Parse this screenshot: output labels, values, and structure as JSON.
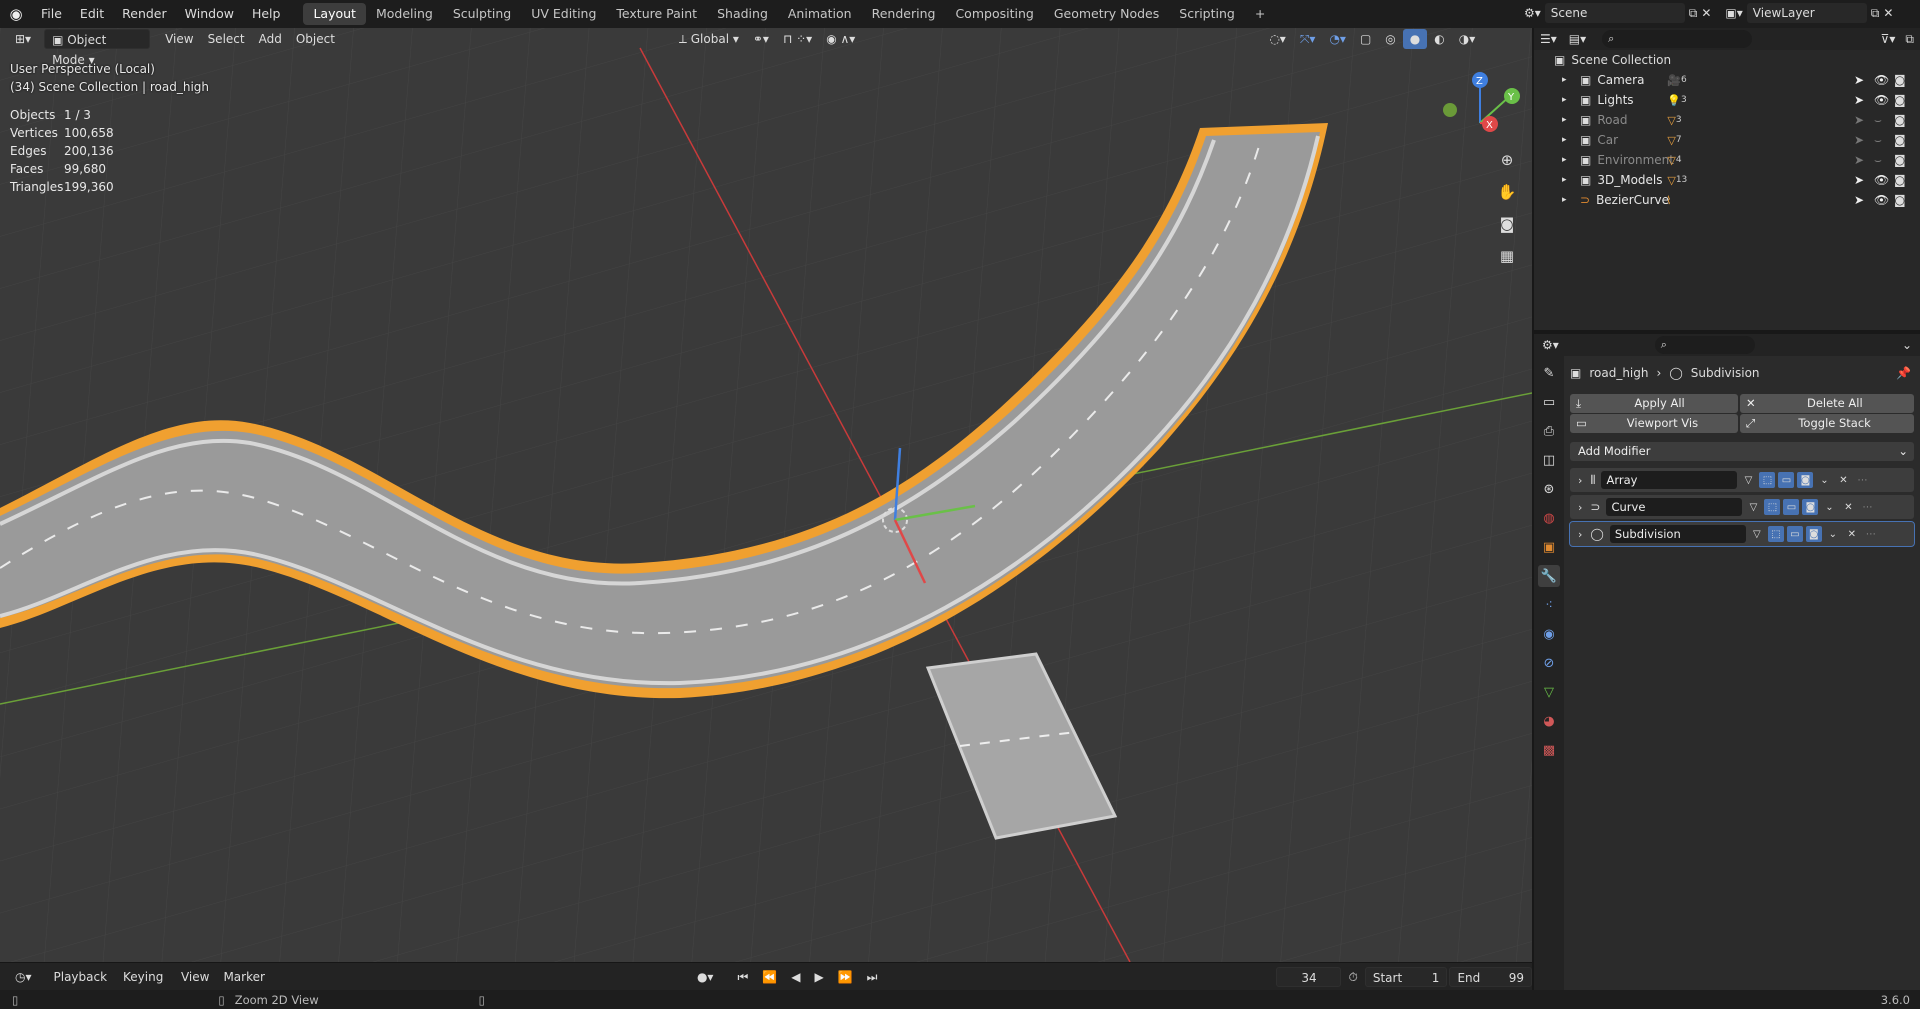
{
  "topbar": {
    "menus": [
      "File",
      "Edit",
      "Render",
      "Window",
      "Help"
    ],
    "workspaces": [
      "Layout",
      "Modeling",
      "Sculpting",
      "UV Editing",
      "Texture Paint",
      "Shading",
      "Animation",
      "Rendering",
      "Compositing",
      "Geometry Nodes",
      "Scripting"
    ],
    "active_workspace": "Layout",
    "add_symbol": "+",
    "scene_label": "Scene",
    "viewlayer_label": "ViewLayer"
  },
  "viewport": {
    "mode": "Object Mode",
    "menus": [
      "View",
      "Select",
      "Add",
      "Object"
    ],
    "transform_orientation": "Global",
    "perspective_text": "User Perspective (Local)",
    "collection_text": "(34) Scene Collection | road_high",
    "stats": [
      {
        "key": "Objects",
        "value": "1 / 3"
      },
      {
        "key": "Vertices",
        "value": "100,658"
      },
      {
        "key": "Edges",
        "value": "200,136"
      },
      {
        "key": "Faces",
        "value": "99,680"
      },
      {
        "key": "Triangles",
        "value": "199,360"
      }
    ],
    "gizmo_axes": {
      "x": "X",
      "y": "Y",
      "z": "Z"
    },
    "colors": {
      "bg": "#3a3a3a",
      "selection": "#f0a030",
      "x_axis": "#c83a3a",
      "y_axis": "#6aa038"
    }
  },
  "outliner": {
    "root": "Scene Collection",
    "items": [
      {
        "name": "Camera",
        "count": "6",
        "icon": "camera-icon",
        "dim": false
      },
      {
        "name": "Lights",
        "count": "3",
        "icon": "light-icon",
        "dim": false
      },
      {
        "name": "Road",
        "count": "3",
        "icon": "mesh-icon",
        "dim": true
      },
      {
        "name": "Car",
        "count": "7",
        "icon": "mesh-icon",
        "dim": true
      },
      {
        "name": "Environment",
        "count": "4",
        "icon": "mesh-icon",
        "dim": true
      },
      {
        "name": "3D_Models",
        "count": "13",
        "icon": "mesh-icon",
        "dim": false
      },
      {
        "name": "BezierCurve",
        "count": "",
        "icon": "curve-icon",
        "dim": false
      }
    ]
  },
  "properties": {
    "breadcrumb_object": "road_high",
    "breadcrumb_modifier": "Subdivision",
    "apply_all": "Apply All",
    "delete_all": "Delete All",
    "viewport_vis": "Viewport Vis",
    "toggle_stack": "Toggle Stack",
    "add_modifier": "Add Modifier",
    "modifiers": [
      {
        "name": "Array",
        "icon": "array-icon",
        "active": false
      },
      {
        "name": "Curve",
        "icon": "curve-modifier-icon",
        "active": false
      },
      {
        "name": "Subdivision",
        "icon": "subdivision-icon",
        "active": true
      }
    ]
  },
  "timeline": {
    "menus": [
      "Playback",
      "Keying",
      "View",
      "Marker"
    ],
    "current_frame": "34",
    "start_label": "Start",
    "start_value": "1",
    "end_label": "End",
    "end_value": "99"
  },
  "statusbar": {
    "hint": "Zoom 2D View",
    "version": "3.6.0"
  }
}
